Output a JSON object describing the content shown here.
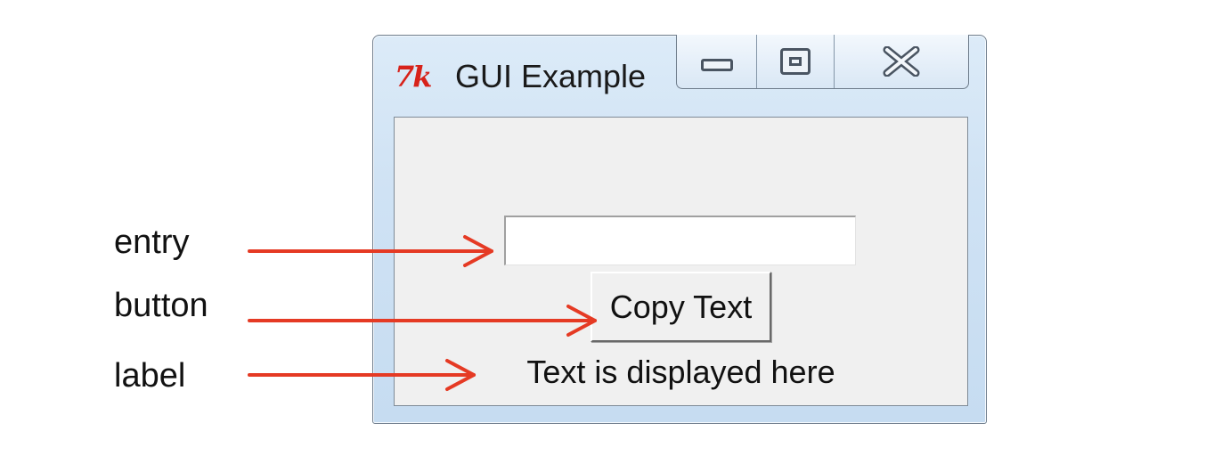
{
  "annotations": {
    "entry": "entry",
    "button": "button",
    "label": "label"
  },
  "window": {
    "title": "GUI Example",
    "icon_text": "7k",
    "icon": "tk-feather-icon"
  },
  "title_controls": {
    "minimize_icon": "minimize-icon",
    "maximize_icon": "maximize-icon",
    "close_icon": "close-icon"
  },
  "form": {
    "entry_value": "",
    "button_label": "Copy Text",
    "output_label": "Text is displayed here"
  },
  "colors": {
    "arrow": "#e53a24",
    "icon_red": "#d7221a",
    "client_bg": "#f0f0f0",
    "frame": "#cfe2f4"
  }
}
